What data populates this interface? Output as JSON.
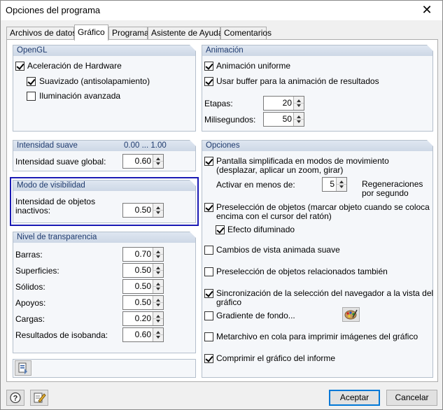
{
  "window": {
    "title": "Opciones del programa",
    "close_glyph": "✕"
  },
  "tabs": [
    {
      "label": "Archivos de datos"
    },
    {
      "label": "Gráfico"
    },
    {
      "label": "Programa"
    },
    {
      "label": "Asistente de Ayuda"
    },
    {
      "label": "Comentarios"
    }
  ],
  "opengl": {
    "header": "OpenGL",
    "hardware": {
      "label": "Aceleración de Hardware",
      "checked": true
    },
    "smoothing": {
      "label": "Suavizado (antisolapamiento)",
      "checked": true
    },
    "lighting": {
      "label": "Iluminación avanzada",
      "checked": false
    }
  },
  "smooth_intensity": {
    "header": "Intensidad suave",
    "range": "0.00 ... 1.00",
    "global_label": "Intensidad suave global:",
    "global_value": "0.60"
  },
  "visibility_mode": {
    "header": "Modo de visibilidad",
    "inactive_label_line1": "Intensidad de objetos",
    "inactive_label_line2": "inactivos:",
    "inactive_value": "0.50"
  },
  "transparency": {
    "header": "Nivel de transparencia",
    "rows": [
      {
        "label": "Barras:",
        "value": "0.70"
      },
      {
        "label": "Superficies:",
        "value": "0.50"
      },
      {
        "label": "Sólidos:",
        "value": "0.50"
      },
      {
        "label": "Apoyos:",
        "value": "0.50"
      },
      {
        "label": "Cargas:",
        "value": "0.20"
      },
      {
        "label": "Resultados de isobanda:",
        "value": "0.60"
      }
    ]
  },
  "animation": {
    "header": "Animación",
    "uniform": {
      "label": "Animación uniforme",
      "checked": true
    },
    "buffer": {
      "label": "Usar buffer para la animación de resultados",
      "checked": true
    },
    "stages_label": "Etapas:",
    "stages_value": "20",
    "ms_label": "Milisegundos:",
    "ms_value": "50"
  },
  "options": {
    "header": "Opciones",
    "simplified": {
      "line1": "Pantalla simplificada en modos de movimiento",
      "line2": "(desplazar, aplicar un zoom, girar)",
      "checked": true
    },
    "activate_label": "Activar en menos de:",
    "activate_value": "5",
    "regen_line1": "Regeneraciones",
    "regen_line2": "por segundo",
    "preselect": {
      "line1": "Preselección de objetos (marcar objeto cuando se coloca",
      "line2": "encima con el cursor del ratón)",
      "checked": true
    },
    "blur": {
      "label": "Efecto difuminado",
      "checked": true
    },
    "animated_view": {
      "label": "Cambios de vista animada suave",
      "checked": false
    },
    "related": {
      "label": "Preselección de objetos relacionados también",
      "checked": false
    },
    "sync": {
      "line1": "Sincronización de la selección del navegador a la vista del",
      "line2": "gráfico",
      "checked": true
    },
    "gradient": {
      "label": "Gradiente de fondo...",
      "checked": false
    },
    "metafile": {
      "label": "Metarchivo en cola para imprimir imágenes del gráfico",
      "checked": false
    },
    "compress": {
      "label": "Comprimir el gráfico del informe",
      "checked": true
    }
  },
  "footer": {
    "accept": "Aceptar",
    "cancel": "Cancelar"
  }
}
